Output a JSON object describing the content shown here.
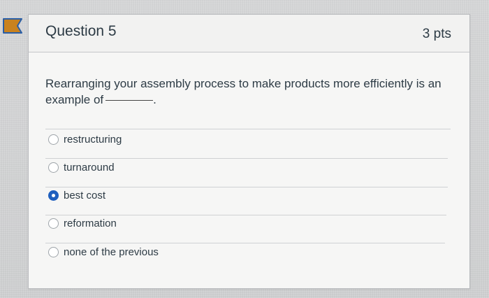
{
  "question": {
    "title": "Question 5",
    "points": "3 pts",
    "text": "Rearranging your assembly process to make products more efficiently is an example of",
    "text_end": "."
  },
  "options": [
    {
      "label": "restructuring",
      "selected": false
    },
    {
      "label": "turnaround",
      "selected": false
    },
    {
      "label": "best cost",
      "selected": true
    },
    {
      "label": "reformation",
      "selected": false
    },
    {
      "label": "none of the previous",
      "selected": false
    }
  ],
  "colors": {
    "accent": "#1f5fbe",
    "flag": "#c9821f",
    "text": "#2d3b45"
  },
  "icons": {
    "flag": "bookmark-flag-icon"
  }
}
